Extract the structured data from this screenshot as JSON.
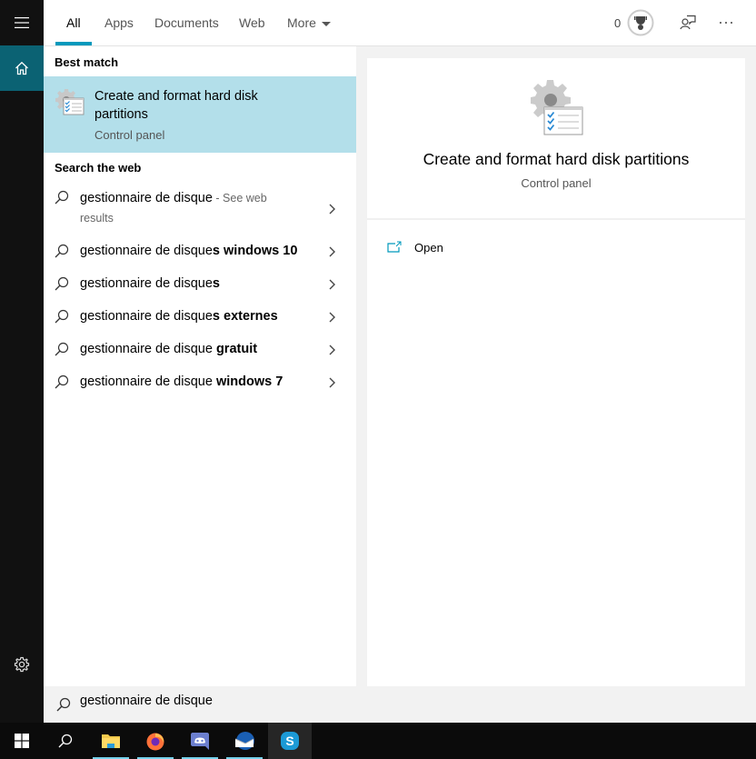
{
  "sidebar": {
    "menu_icon": "hamburger-icon",
    "home_icon": "home-icon",
    "settings_icon": "gear-icon"
  },
  "header": {
    "tabs": [
      {
        "label": "All",
        "active": true
      },
      {
        "label": "Apps"
      },
      {
        "label": "Documents"
      },
      {
        "label": "Web"
      },
      {
        "label": "More"
      }
    ],
    "points": "0",
    "trophy_icon": "trophy-icon",
    "feedback_icon": "feedback-icon",
    "more_options_icon": "ellipsis-icon",
    "accent": "#0099bc"
  },
  "left": {
    "best_match_heading": "Best match",
    "best_match": {
      "title": "Create and format hard disk partitions",
      "subtitle": "Control panel",
      "icon": "control-panel-gear-checklist-icon",
      "highlight": "#b3dfea"
    },
    "web_heading": "Search the web",
    "web_results": [
      {
        "prefix": "gestionnaire de disque",
        "bold": "",
        "suffix": " - See web results"
      },
      {
        "prefix": "gestionnaire de disque",
        "bold": "s windows 10",
        "suffix": ""
      },
      {
        "prefix": "gestionnaire de disque",
        "bold": "s",
        "suffix": ""
      },
      {
        "prefix": "gestionnaire de disque",
        "bold": "s externes",
        "suffix": ""
      },
      {
        "prefix": "gestionnaire de disque",
        "bold": " gratuit",
        "suffix": ""
      },
      {
        "prefix": "gestionnaire de disque",
        "bold": " windows 7",
        "suffix": ""
      }
    ]
  },
  "preview": {
    "title": "Create and format hard disk partitions",
    "subtitle": "Control panel",
    "actions": [
      {
        "label": "Open",
        "icon": "open-external-icon"
      }
    ]
  },
  "search": {
    "value": "gestionnaire de disque"
  },
  "taskbar": {
    "items": [
      {
        "name": "start",
        "icon": "windows-logo-icon"
      },
      {
        "name": "search",
        "icon": "search-icon"
      },
      {
        "name": "file-explorer",
        "icon": "folder-icon",
        "running": true
      },
      {
        "name": "firefox",
        "icon": "firefox-icon",
        "running": true
      },
      {
        "name": "discord",
        "icon": "discord-icon",
        "running": true
      },
      {
        "name": "thunderbird",
        "icon": "thunderbird-icon",
        "running": true
      },
      {
        "name": "skype",
        "icon": "skype-icon",
        "active": true
      }
    ]
  }
}
